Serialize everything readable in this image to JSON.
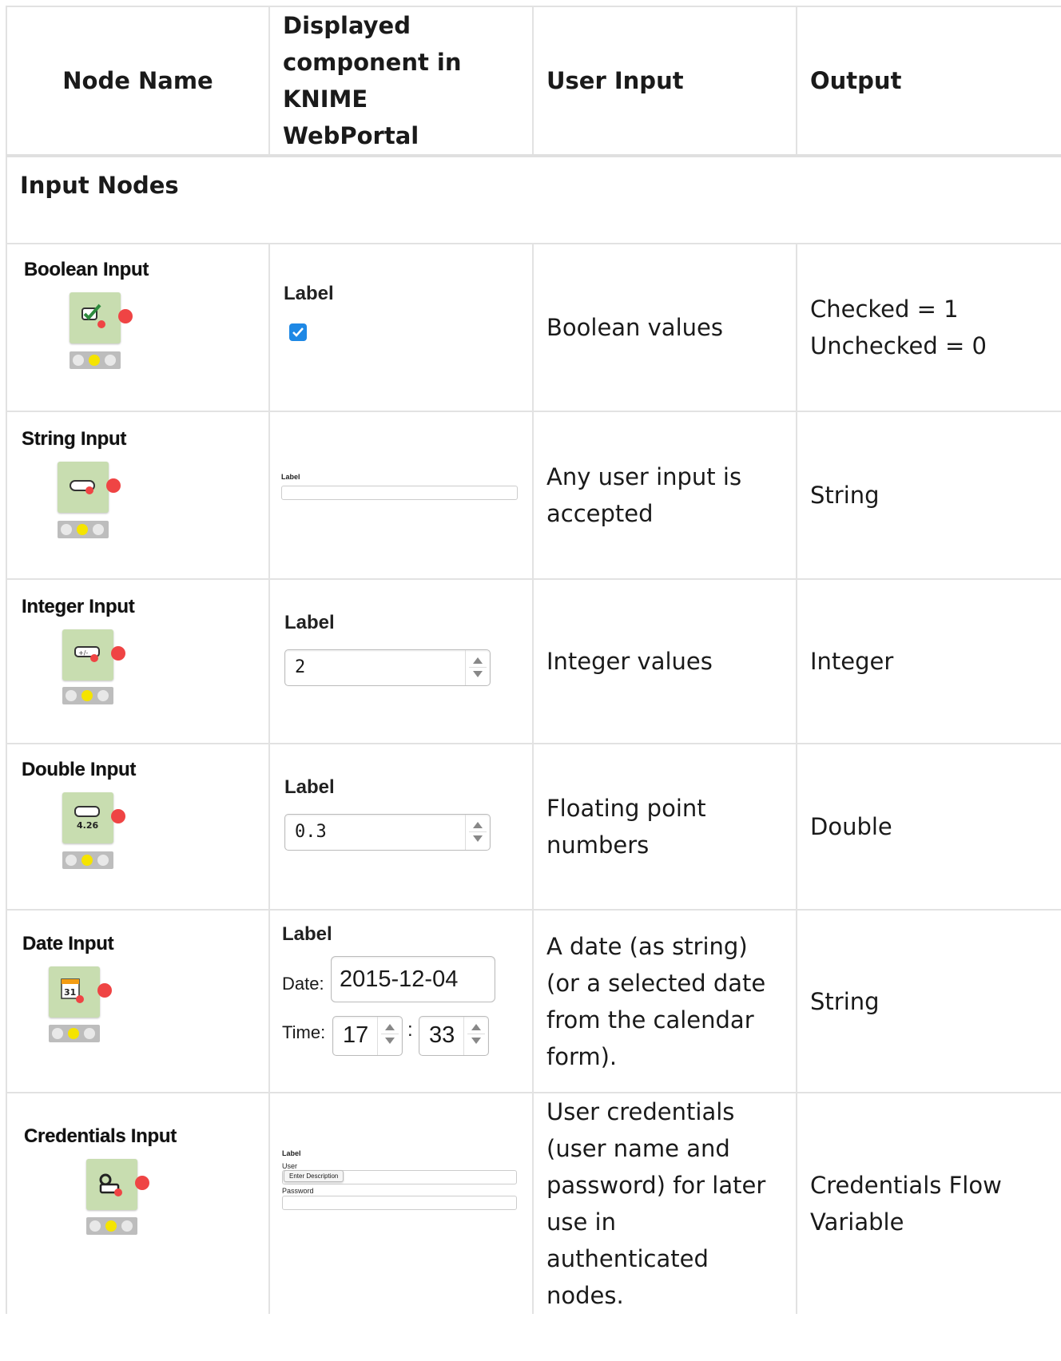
{
  "headers": {
    "node_name": "Node Name",
    "displayed_component": "Displayed component in KNIME WebPortal",
    "user_input": "User Input",
    "output": "Output"
  },
  "section_title": "Input Nodes",
  "rows": [
    {
      "name": "Boolean Input",
      "icon": "checkbox-check-icon",
      "widget": {
        "label": "Label",
        "checked": true
      },
      "user_input": "Boolean values",
      "output_line1": "Checked = 1",
      "output_line2": "Unchecked = 0"
    },
    {
      "name": "String Input",
      "icon": "text-field-icon",
      "widget": {
        "label": "Label"
      },
      "user_input": "Any user input is accepted",
      "output": "String"
    },
    {
      "name": "Integer Input",
      "icon": "integer-field-icon",
      "widget": {
        "label": "Label",
        "value": "2"
      },
      "user_input": "Integer values",
      "output": "Integer"
    },
    {
      "name": "Double Input",
      "icon": "double-field-icon",
      "icon_text": "4.26",
      "widget": {
        "label": "Label",
        "value": "0.3"
      },
      "user_input": "Floating point numbers",
      "output": "Double"
    },
    {
      "name": "Date Input",
      "icon": "calendar-icon",
      "icon_text": "31",
      "widget": {
        "label": "Label",
        "date_label": "Date:",
        "date_value": "2015-12-04",
        "time_label": "Time:",
        "hour": "17",
        "minute": "33",
        "separator": ":"
      },
      "user_input": "A date (as string) (or a selected date from the calendar form).",
      "output": "String"
    },
    {
      "name": "Credentials Input",
      "icon": "key-user-icon",
      "widget": {
        "label": "Label",
        "user_label": "User",
        "user_placeholder": "Enter Description",
        "password_label": "Password"
      },
      "user_input": "User credentials (user name and password) for later use in authenticated nodes.",
      "output": "Credentials Flow Variable"
    }
  ],
  "colors": {
    "node_green": "#c8ddb0",
    "port_red": "#ef4444",
    "light_yellow": "#f5e400",
    "checkbox_blue": "#1e88e5",
    "grid": "#e2e2e2"
  }
}
